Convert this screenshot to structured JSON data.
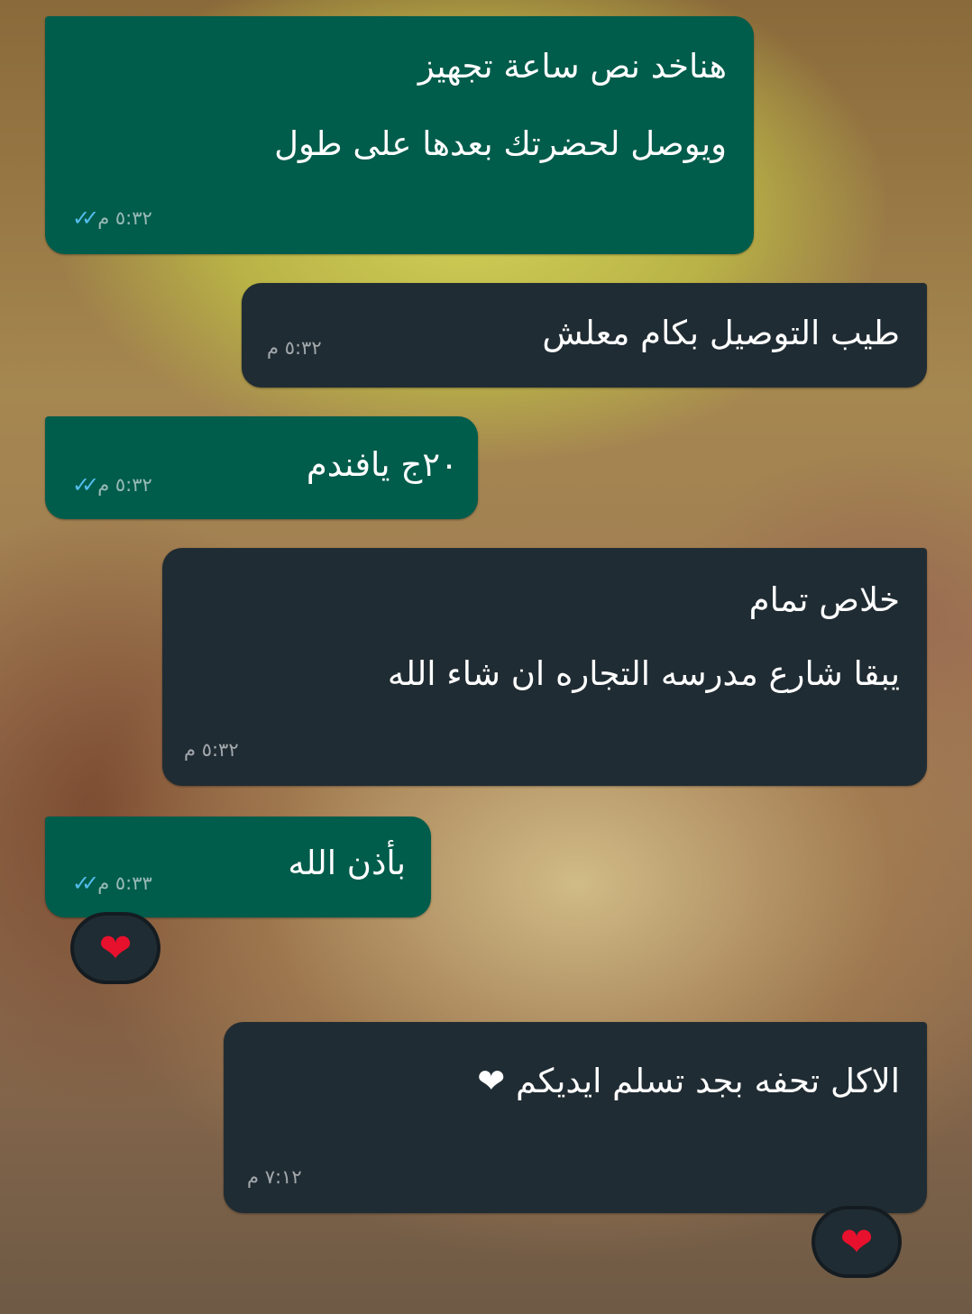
{
  "messages": [
    {
      "id": "m1",
      "direction": "outgoing",
      "lines": [
        "هناخد نص ساعة تجهيز",
        "ويوصل لحضرتك بعدها على طول"
      ],
      "time": "٥:٣٢ م",
      "status": "read"
    },
    {
      "id": "m2",
      "direction": "incoming",
      "lines": [
        "طيب التوصيل بكام معلش"
      ],
      "time": "٥:٣٢ م"
    },
    {
      "id": "m3",
      "direction": "outgoing",
      "lines": [
        "٢٠ج يافندم"
      ],
      "time": "٥:٣٢ م",
      "status": "read"
    },
    {
      "id": "m4",
      "direction": "incoming",
      "lines": [
        "خلاص تمام",
        "يبقا شارع مدرسه التجاره ان شاء الله"
      ],
      "time": "٥:٣٢ م"
    },
    {
      "id": "m5",
      "direction": "outgoing",
      "lines": [
        "بأذن الله"
      ],
      "time": "٥:٣٣ م",
      "status": "read",
      "reaction": "❤"
    },
    {
      "id": "m6",
      "direction": "incoming",
      "lines": [
        "الاكل تحفه بجد تسلم ايديكم ❤"
      ],
      "time": "٧:١٢ م",
      "reaction": "❤"
    }
  ],
  "read_ticks": "✓✓",
  "colors": {
    "outgoing": "#005c4b",
    "incoming": "#202c33",
    "ticks": "#53bdeb",
    "heart": "#e8112d"
  }
}
